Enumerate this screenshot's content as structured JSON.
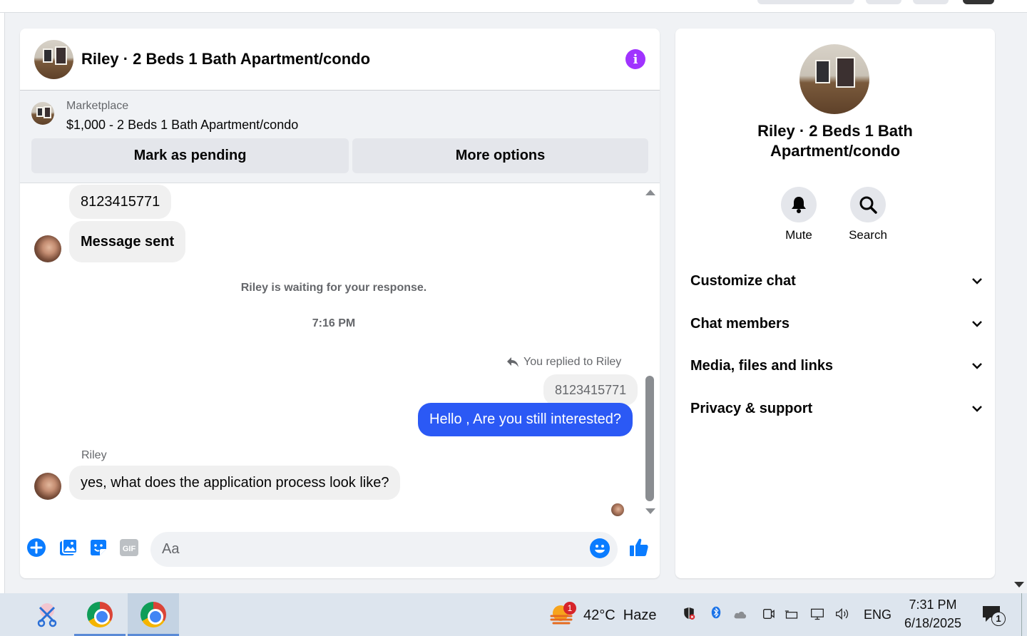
{
  "chat": {
    "title": "Riley · 2 Beds 1 Bath Apartment/condo",
    "marketplace_label": "Marketplace",
    "listing": "$1,000 - 2 Beds 1 Bath Apartment/condo",
    "mark_pending_label": "Mark as pending",
    "more_options_label": "More options"
  },
  "messages": {
    "phone_in": "8123415771",
    "message_sent": "Message sent",
    "waiting_notice": "Riley is waiting for your response.",
    "timestamp": "7:16 PM",
    "replied_to": "You replied to Riley",
    "quoted": "8123415771",
    "outgoing": "Hello , Are you still interested?",
    "sender": "Riley",
    "incoming": "yes, what does the application process look like?"
  },
  "composer": {
    "placeholder": "Aa",
    "gif_label": "GIF"
  },
  "info_panel": {
    "name": "Riley · 2 Beds 1 Bath Apartment/condo",
    "mute_label": "Mute",
    "search_label": "Search",
    "sections": [
      "Customize chat",
      "Chat members",
      "Media, files and links",
      "Privacy & support"
    ]
  },
  "taskbar": {
    "weather_badge": "1",
    "weather": "42°C  Haze",
    "language": "ENG",
    "time": "7:31 PM",
    "date": "6/18/2025",
    "notifications": "1"
  },
  "colors": {
    "accent_blue": "#0a7cff",
    "outgoing_bubble": "#2b59f5",
    "info_purple": "#a033ff"
  }
}
